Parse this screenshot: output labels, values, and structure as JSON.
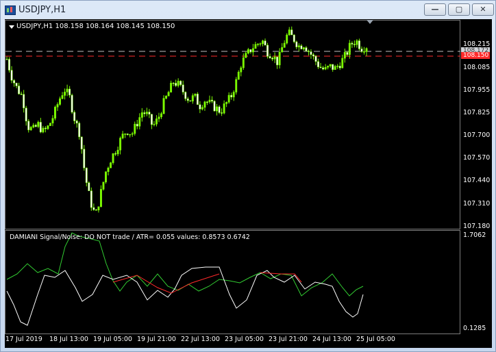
{
  "window": {
    "title": "USDJPY,H1",
    "min_label": "—",
    "max_label": "▢",
    "close_label": "✕"
  },
  "header": {
    "ohlc_text": "USDJPY,H1  108.158 108.164 108.145 108.150"
  },
  "price_axis": [
    "108.215",
    "108.085",
    "107.955",
    "107.825",
    "107.700",
    "107.570",
    "107.440",
    "107.310",
    "107.180"
  ],
  "price_tags": {
    "ask": "108.172",
    "bid": "108.150"
  },
  "indicator": {
    "label": "DAMIANI Signal/Noise: DO NOT trade  /  ATR= 0.055    values: 0.8573 0.6742",
    "axis_top": "1.7062",
    "axis_bottom": "0.1285"
  },
  "time_axis": [
    "17 Jul 2019",
    "18 Jul 13:00",
    "19 Jul 05:00",
    "19 Jul 21:00",
    "22 Jul 13:00",
    "23 Jul 05:00",
    "23 Jul 21:00",
    "24 Jul 13:00",
    "25 Jul 05:00"
  ],
  "colors": {
    "bull": "#7cfc00",
    "bear": "#ffffff",
    "signal": "#32cd32",
    "noise": "#ffffff",
    "trend": "#ff2a2a",
    "bid_line": "#ff2a2a",
    "ask_line": "#c0c0c0"
  },
  "chart_data": [
    {
      "type": "candlestick",
      "symbol": "USDJPY",
      "timeframe": "H1",
      "ylim": [
        107.18,
        108.25
      ],
      "close_path": [
        108.08,
        107.98,
        107.92,
        107.88,
        107.72,
        107.7,
        107.73,
        107.69,
        107.72,
        107.78,
        107.86,
        107.92,
        107.88,
        107.76,
        107.68,
        107.46,
        107.32,
        107.24,
        107.36,
        107.48,
        107.55,
        107.6,
        107.66,
        107.7,
        107.68,
        107.74,
        107.8,
        107.78,
        107.72,
        107.76,
        107.84,
        107.9,
        107.96,
        107.94,
        107.9,
        107.86,
        107.88,
        107.83,
        107.86,
        107.84,
        107.82,
        107.8,
        107.84,
        107.88,
        107.96,
        108.06,
        108.1,
        108.14,
        108.16,
        108.18,
        108.12,
        108.1,
        108.06,
        108.16,
        108.22,
        108.19,
        108.15,
        108.16,
        108.12,
        108.08,
        108.04,
        108.02,
        108.04,
        108.03,
        108.06,
        108.1,
        108.16,
        108.18,
        108.14,
        108.15
      ]
    },
    {
      "type": "line",
      "name": "DAMIANI Signal/Noise",
      "ylim": [
        0.1285,
        1.7062
      ],
      "values": [
        0.8573,
        0.6742
      ]
    }
  ]
}
